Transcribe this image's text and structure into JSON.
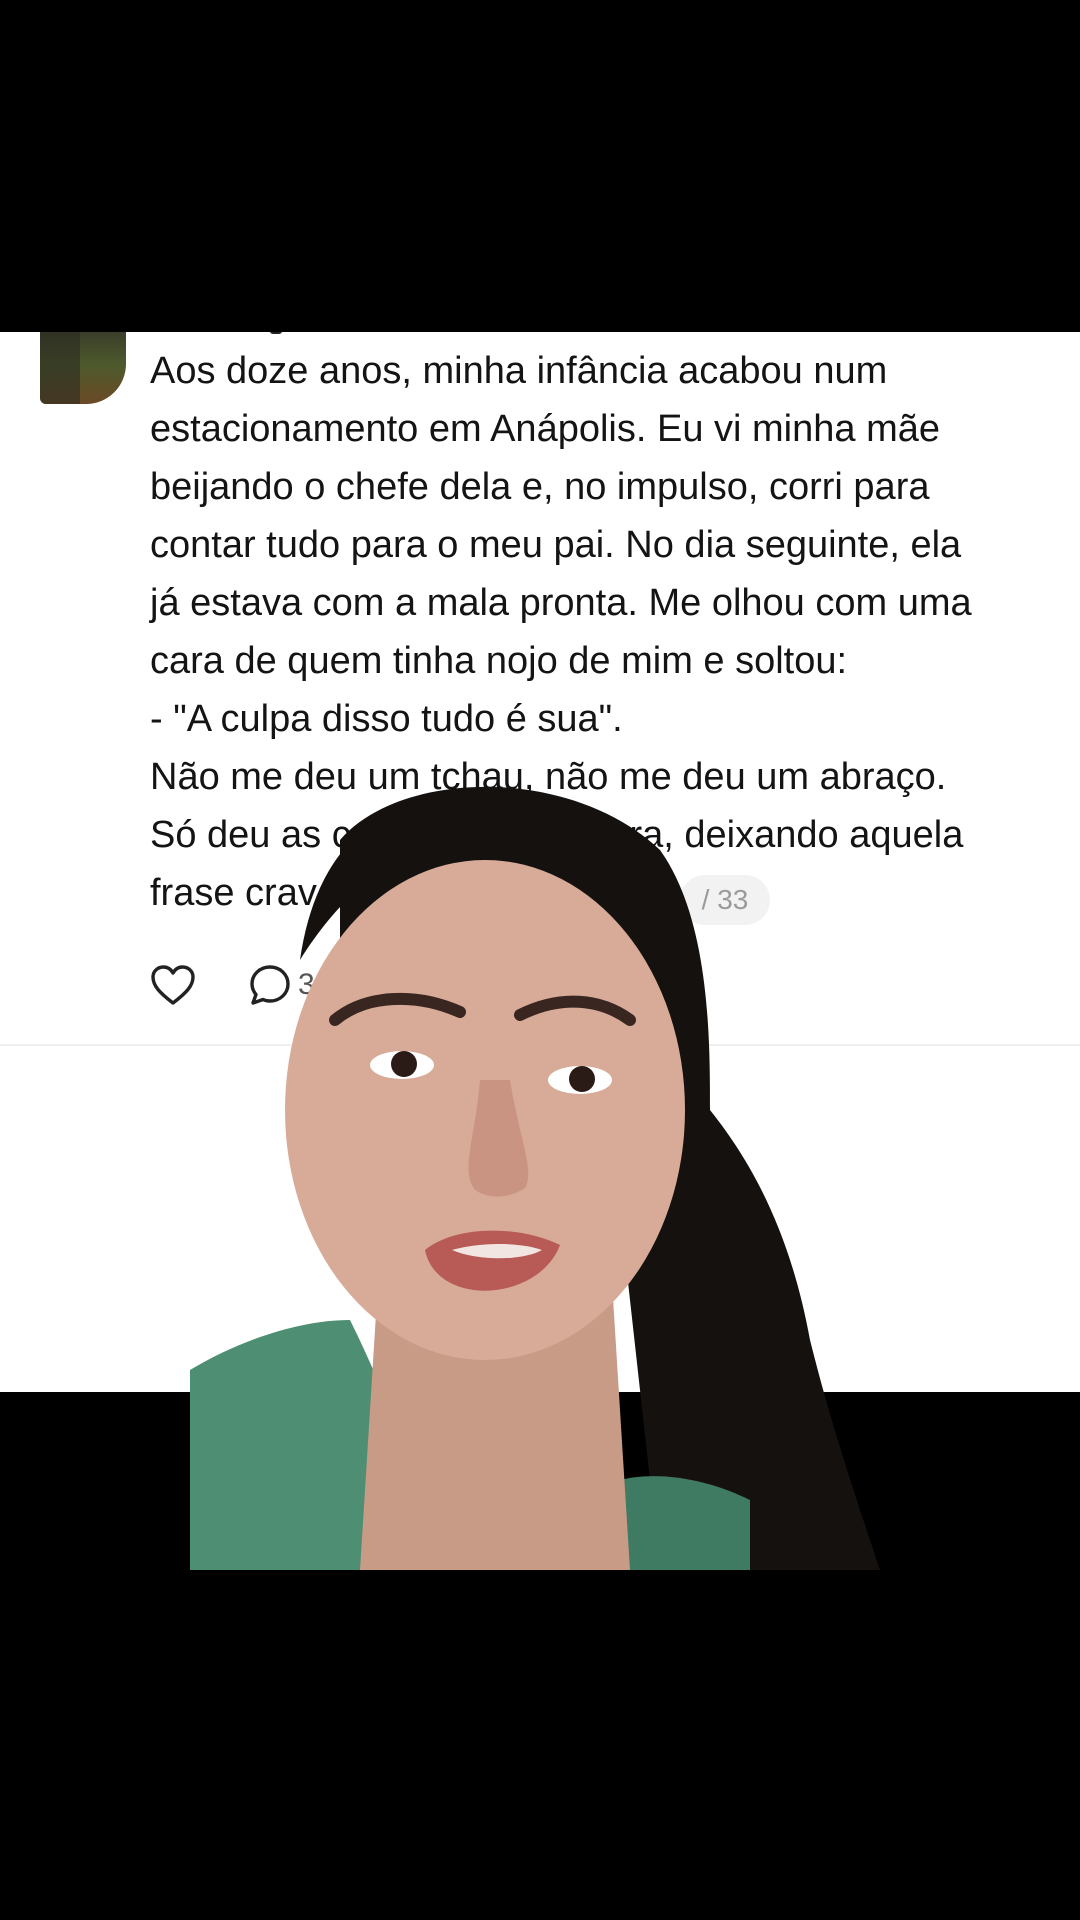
{
  "post": {
    "lines": [
      "Aos doze anos, minha infância acabou num",
      "estacionamento em Anápolis. Eu vi minha mãe",
      "beijando o chefe dela e, no impulso, corri para",
      "contar tudo para o meu pai. No dia seguinte, ela",
      "já estava com a mala pronta. Me olhou com uma",
      "cara de quem tinha nojo de mim e soltou:",
      "- \"A culpa disso tudo é sua\".",
      "Não me deu um tchau, não me deu um abraço.",
      "Só deu as costas e foi embora, deixando aquela",
      "frase cravada"
    ],
    "page_counter": "/ 33"
  },
  "actions": {
    "like_icon": "heart-icon",
    "comment_icon": "comment-icon",
    "comment_count": "3"
  },
  "colors": {
    "card_background": "#ffffff",
    "frame_background": "#000000",
    "text": "#141414",
    "muted": "#9b9b9b"
  }
}
